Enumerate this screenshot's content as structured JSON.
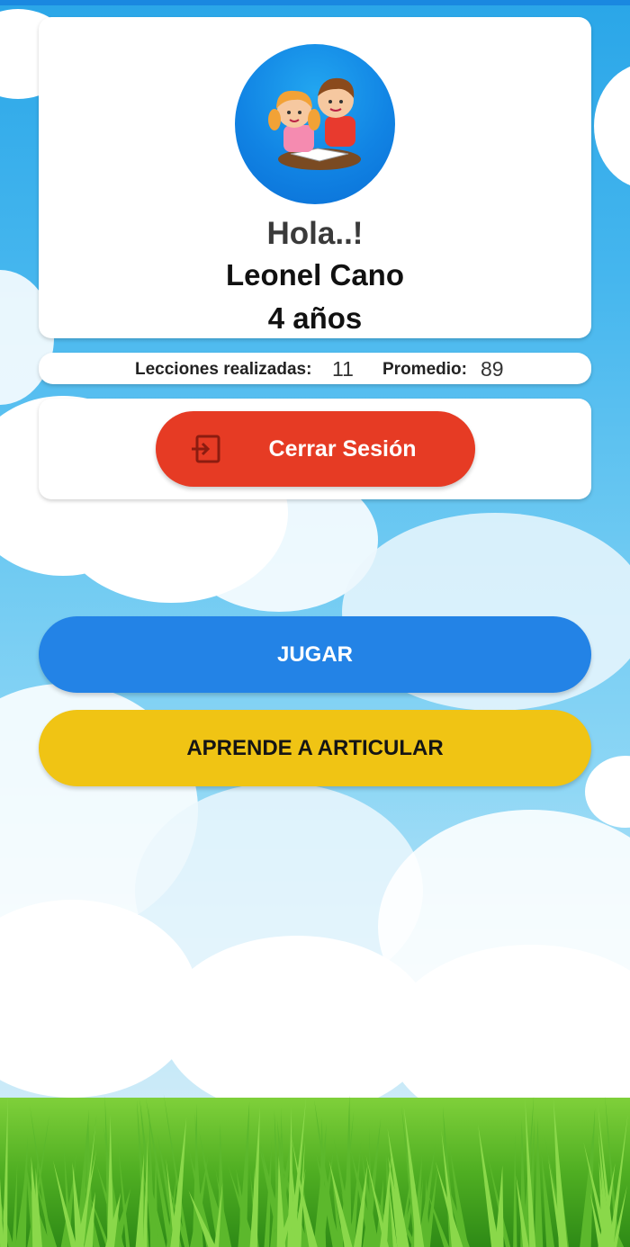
{
  "profile": {
    "greeting": "Hola..!",
    "name": "Leonel Cano",
    "age": "4 años"
  },
  "stats": {
    "lessons_label": "Lecciones realizadas:",
    "lessons_value": "11",
    "average_label": "Promedio:",
    "average_value": "89"
  },
  "logout": {
    "label": "Cerrar Sesión",
    "icon": "logout-icon"
  },
  "actions": {
    "play_label": "JUGAR",
    "learn_label": "APRENDE A ARTICULAR"
  },
  "colors": {
    "logout": "#e63b24",
    "play": "#2383e6",
    "learn": "#f0c414",
    "sky": "#45b6ee",
    "grass": "#5cb82c"
  }
}
